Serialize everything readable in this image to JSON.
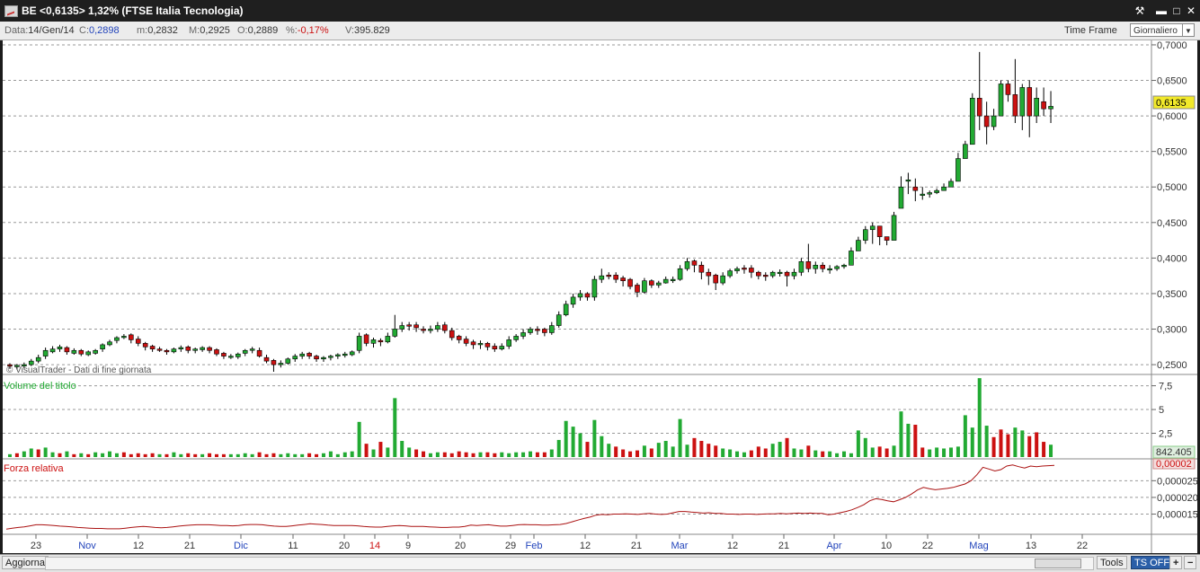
{
  "window": {
    "title": "BE <0,6135> 1,32%  (FTSE Italia Tecnologia)",
    "buttons": [
      "wrench-icon",
      "minimize-icon",
      "maximize-icon",
      "close-icon"
    ]
  },
  "info": {
    "date_label": "Data:",
    "date": "14/Gen/14",
    "close_label": "C:",
    "close": "0,2898",
    "min_label": "m:",
    "min": "0,2832",
    "max_label": "M:",
    "max": "0,2925",
    "open_label": "O:",
    "open": "0,2889",
    "pct_label": "%:",
    "pct": "-0,17%",
    "vol_label": "V:",
    "vol": "395.829",
    "time_frame_label": "Time Frame",
    "time_frame_value": "Giornaliero"
  },
  "price_panel": {
    "watermark": "© VisualTrader - Dati di fine giornata",
    "y_ticks": [
      "0,7000",
      "0,6500",
      "0,6000",
      "0,5500",
      "0,5000",
      "0,4500",
      "0,4000",
      "0,3500",
      "0,3000",
      "0,2500"
    ],
    "last_price_label": "0,6135"
  },
  "volume_panel": {
    "title": "Volume del titolo",
    "y_ticks": [
      "7,5",
      "5",
      "2,5"
    ],
    "last_label": "842.405"
  },
  "rs_panel": {
    "title": "Forza relativa",
    "y_ticks": [
      "0,000025",
      "0,000020",
      "0,000015"
    ],
    "last_label": "0,00002"
  },
  "x_axis": {
    "labels": [
      "23",
      "Nov",
      "12",
      "21",
      "Dic",
      "11",
      "20",
      "14",
      "9",
      "20",
      "29",
      "Feb",
      "12",
      "21",
      "Mar",
      "12",
      "21",
      "Apr",
      "10",
      "22",
      "Mag",
      "13",
      "22"
    ]
  },
  "bottom": {
    "refresh_label": "Aggiorna",
    "tools_label": "Tools",
    "ts_label": "TS OFF",
    "plus_label": "+",
    "minus_label": "−"
  },
  "colors": {
    "up": "#22aa33",
    "down": "#cc1111",
    "rs_line": "#aa1111",
    "grid": "#999999",
    "accent_label": "#f2e92a"
  },
  "chart_data": [
    {
      "type": "candlestick",
      "title": "BE <0,6135> 1,32%  (FTSE Italia Tecnologia)",
      "ylim": [
        0.24,
        0.705
      ],
      "x_labels": [
        "23",
        "Nov",
        "12",
        "21",
        "Dic",
        "11",
        "20",
        "14",
        "9",
        "20",
        "29",
        "Feb",
        "12",
        "21",
        "Mar",
        "12",
        "21",
        "Apr",
        "10",
        "22",
        "Mag",
        "13",
        "22"
      ],
      "close": [
        0.248,
        0.249,
        0.25,
        0.255,
        0.26,
        0.27,
        0.272,
        0.275,
        0.268,
        0.27,
        0.265,
        0.268,
        0.27,
        0.278,
        0.282,
        0.288,
        0.29,
        0.285,
        0.28,
        0.275,
        0.272,
        0.27,
        0.268,
        0.272,
        0.274,
        0.27,
        0.272,
        0.274,
        0.27,
        0.265,
        0.262,
        0.262,
        0.265,
        0.27,
        0.272,
        0.262,
        0.255,
        0.25,
        0.252,
        0.258,
        0.262,
        0.265,
        0.262,
        0.258,
        0.26,
        0.262,
        0.264,
        0.265,
        0.268,
        0.29,
        0.28,
        0.285,
        0.282,
        0.29,
        0.3,
        0.305,
        0.305,
        0.302,
        0.298,
        0.3,
        0.305,
        0.298,
        0.288,
        0.285,
        0.28,
        0.278,
        0.28,
        0.275,
        0.272,
        0.276,
        0.285,
        0.29,
        0.295,
        0.3,
        0.298,
        0.295,
        0.305,
        0.32,
        0.335,
        0.345,
        0.35,
        0.345,
        0.37,
        0.375,
        0.375,
        0.37,
        0.368,
        0.36,
        0.352,
        0.368,
        0.362,
        0.365,
        0.37,
        0.37,
        0.385,
        0.395,
        0.39,
        0.38,
        0.375,
        0.365,
        0.375,
        0.382,
        0.385,
        0.385,
        0.38,
        0.375,
        0.375,
        0.38,
        0.38,
        0.375,
        0.38,
        0.395,
        0.385,
        0.39,
        0.385,
        0.385,
        0.388,
        0.39,
        0.41,
        0.425,
        0.44,
        0.445,
        0.43,
        0.425,
        0.46,
        0.5,
        0.51,
        0.495,
        0.49,
        0.492,
        0.495,
        0.5,
        0.508,
        0.54,
        0.56,
        0.625,
        0.6,
        0.585,
        0.6,
        0.645,
        0.63,
        0.6,
        0.64,
        0.6,
        0.625,
        0.61,
        0.6135
      ],
      "open": [
        0.25,
        0.247,
        0.248,
        0.25,
        0.255,
        0.262,
        0.268,
        0.272,
        0.274,
        0.266,
        0.27,
        0.264,
        0.266,
        0.272,
        0.278,
        0.284,
        0.29,
        0.292,
        0.286,
        0.28,
        0.276,
        0.272,
        0.27,
        0.268,
        0.272,
        0.275,
        0.27,
        0.271,
        0.274,
        0.271,
        0.266,
        0.262,
        0.261,
        0.266,
        0.272,
        0.27,
        0.26,
        0.256,
        0.25,
        0.252,
        0.258,
        0.262,
        0.266,
        0.262,
        0.258,
        0.26,
        0.262,
        0.263,
        0.264,
        0.27,
        0.292,
        0.28,
        0.284,
        0.282,
        0.29,
        0.3,
        0.306,
        0.306,
        0.3,
        0.298,
        0.3,
        0.306,
        0.298,
        0.29,
        0.286,
        0.282,
        0.278,
        0.28,
        0.276,
        0.272,
        0.276,
        0.285,
        0.29,
        0.295,
        0.3,
        0.3,
        0.295,
        0.305,
        0.32,
        0.335,
        0.345,
        0.35,
        0.345,
        0.37,
        0.376,
        0.376,
        0.372,
        0.37,
        0.362,
        0.352,
        0.368,
        0.362,
        0.365,
        0.37,
        0.37,
        0.385,
        0.396,
        0.39,
        0.38,
        0.376,
        0.365,
        0.375,
        0.382,
        0.386,
        0.386,
        0.38,
        0.376,
        0.375,
        0.38,
        0.38,
        0.375,
        0.38,
        0.395,
        0.385,
        0.39,
        0.385,
        0.385,
        0.388,
        0.39,
        0.41,
        0.425,
        0.44,
        0.445,
        0.43,
        0.425,
        0.47,
        0.51,
        0.5,
        0.49,
        0.49,
        0.492,
        0.495,
        0.5,
        0.508,
        0.54,
        0.56,
        0.625,
        0.6,
        0.585,
        0.6,
        0.645,
        0.63,
        0.6,
        0.64,
        0.6,
        0.62,
        0.61
      ],
      "high": [
        0.252,
        0.251,
        0.253,
        0.258,
        0.264,
        0.274,
        0.276,
        0.278,
        0.276,
        0.273,
        0.272,
        0.27,
        0.272,
        0.28,
        0.285,
        0.29,
        0.293,
        0.294,
        0.29,
        0.282,
        0.278,
        0.275,
        0.272,
        0.274,
        0.277,
        0.277,
        0.274,
        0.276,
        0.276,
        0.273,
        0.268,
        0.265,
        0.267,
        0.272,
        0.275,
        0.274,
        0.264,
        0.258,
        0.256,
        0.26,
        0.265,
        0.268,
        0.268,
        0.264,
        0.262,
        0.264,
        0.266,
        0.268,
        0.27,
        0.295,
        0.294,
        0.288,
        0.287,
        0.295,
        0.32,
        0.31,
        0.31,
        0.31,
        0.304,
        0.305,
        0.31,
        0.31,
        0.302,
        0.292,
        0.29,
        0.285,
        0.284,
        0.282,
        0.28,
        0.28,
        0.29,
        0.293,
        0.3,
        0.303,
        0.304,
        0.302,
        0.31,
        0.325,
        0.34,
        0.35,
        0.355,
        0.352,
        0.375,
        0.385,
        0.38,
        0.38,
        0.375,
        0.372,
        0.365,
        0.372,
        0.37,
        0.368,
        0.374,
        0.374,
        0.39,
        0.4,
        0.398,
        0.395,
        0.385,
        0.378,
        0.38,
        0.385,
        0.388,
        0.39,
        0.39,
        0.382,
        0.38,
        0.382,
        0.384,
        0.382,
        0.385,
        0.4,
        0.42,
        0.395,
        0.394,
        0.39,
        0.39,
        0.392,
        0.415,
        0.43,
        0.445,
        0.45,
        0.445,
        0.43,
        0.465,
        0.515,
        0.52,
        0.512,
        0.5,
        0.495,
        0.498,
        0.505,
        0.512,
        0.548,
        0.565,
        0.632,
        0.69,
        0.62,
        0.61,
        0.65,
        0.65,
        0.68,
        0.645,
        0.65,
        0.64,
        0.64,
        0.635
      ],
      "low": [
        0.244,
        0.243,
        0.245,
        0.248,
        0.252,
        0.258,
        0.266,
        0.268,
        0.264,
        0.264,
        0.262,
        0.262,
        0.264,
        0.268,
        0.276,
        0.28,
        0.286,
        0.28,
        0.276,
        0.27,
        0.268,
        0.268,
        0.264,
        0.266,
        0.268,
        0.266,
        0.266,
        0.268,
        0.266,
        0.262,
        0.258,
        0.258,
        0.258,
        0.262,
        0.266,
        0.26,
        0.252,
        0.24,
        0.246,
        0.25,
        0.254,
        0.258,
        0.258,
        0.254,
        0.254,
        0.256,
        0.258,
        0.26,
        0.262,
        0.266,
        0.276,
        0.274,
        0.276,
        0.28,
        0.288,
        0.296,
        0.298,
        0.296,
        0.294,
        0.294,
        0.296,
        0.294,
        0.284,
        0.28,
        0.276,
        0.272,
        0.272,
        0.27,
        0.268,
        0.27,
        0.272,
        0.282,
        0.286,
        0.292,
        0.292,
        0.29,
        0.292,
        0.302,
        0.318,
        0.33,
        0.34,
        0.34,
        0.34,
        0.365,
        0.37,
        0.365,
        0.36,
        0.356,
        0.345,
        0.35,
        0.358,
        0.358,
        0.364,
        0.365,
        0.368,
        0.382,
        0.38,
        0.37,
        0.362,
        0.355,
        0.362,
        0.372,
        0.378,
        0.378,
        0.372,
        0.37,
        0.368,
        0.372,
        0.374,
        0.36,
        0.37,
        0.375,
        0.38,
        0.378,
        0.38,
        0.378,
        0.382,
        0.385,
        0.405,
        0.418,
        0.42,
        0.42,
        0.418,
        0.418,
        0.455,
        0.48,
        0.49,
        0.48,
        0.482,
        0.485,
        0.49,
        0.495,
        0.505,
        0.53,
        0.55,
        0.6,
        0.58,
        0.56,
        0.58,
        0.6,
        0.62,
        0.59,
        0.58,
        0.57,
        0.59,
        0.6,
        0.59
      ]
    },
    {
      "type": "bar",
      "title": "Volume del titolo",
      "ylim": [
        0,
        8.5
      ],
      "values": [
        0.3,
        0.4,
        0.6,
        0.9,
        0.8,
        1.0,
        0.5,
        0.4,
        0.6,
        0.3,
        0.4,
        0.3,
        0.5,
        0.4,
        0.6,
        0.4,
        0.5,
        0.3,
        0.4,
        0.3,
        0.4,
        0.3,
        0.3,
        0.5,
        0.3,
        0.4,
        0.3,
        0.3,
        0.4,
        0.3,
        0.3,
        0.3,
        0.3,
        0.4,
        0.3,
        0.5,
        0.3,
        0.4,
        0.3,
        0.4,
        0.3,
        0.3,
        0.4,
        0.3,
        0.4,
        0.6,
        0.3,
        0.5,
        0.6,
        3.7,
        1.4,
        0.8,
        1.6,
        1.0,
        6.2,
        1.7,
        1.0,
        0.8,
        0.6,
        0.4,
        0.5,
        0.5,
        0.4,
        0.6,
        0.5,
        0.4,
        0.5,
        0.5,
        0.4,
        0.5,
        0.4,
        0.5,
        0.5,
        0.6,
        0.5,
        0.5,
        0.8,
        1.8,
        3.8,
        3.2,
        2.5,
        1.6,
        3.9,
        2.2,
        1.4,
        1.1,
        0.8,
        0.6,
        0.7,
        1.2,
        0.9,
        1.5,
        1.7,
        1.1,
        4.0,
        1.3,
        2.0,
        1.7,
        1.4,
        1.2,
        0.9,
        0.8,
        0.6,
        0.5,
        0.7,
        1.1,
        0.9,
        1.4,
        1.6,
        2.0,
        0.9,
        0.8,
        1.2,
        0.7,
        0.6,
        0.6,
        0.4,
        0.6,
        0.4,
        2.8,
        2.0,
        1.0,
        1.1,
        0.9,
        1.2,
        4.8,
        3.5,
        3.4,
        1.0,
        0.8,
        1.0,
        0.9,
        1.0,
        1.1,
        4.4,
        3.1,
        8.3,
        3.3,
        2.1,
        2.9,
        2.4,
        3.1,
        2.8,
        2.2,
        2.6,
        1.6,
        1.3,
        0.8
      ],
      "colors": [
        "up",
        "down",
        "up",
        "up",
        "down",
        "up",
        "up",
        "down",
        "up",
        "down",
        "up",
        "down",
        "up",
        "up",
        "up",
        "up",
        "down",
        "down",
        "down",
        "down",
        "down",
        "up",
        "down",
        "up",
        "up",
        "down",
        "down",
        "up",
        "down",
        "down",
        "down",
        "up",
        "up",
        "up",
        "up",
        "down",
        "down",
        "down",
        "up",
        "up",
        "up",
        "up",
        "down",
        "down",
        "up",
        "up",
        "up",
        "up",
        "up",
        "up",
        "down",
        "up",
        "down",
        "up",
        "up",
        "up",
        "up",
        "down",
        "down",
        "up",
        "up",
        "down",
        "down",
        "down",
        "down",
        "down",
        "up",
        "down",
        "down",
        "up",
        "up",
        "up",
        "up",
        "up",
        "down",
        "down",
        "up",
        "up",
        "up",
        "up",
        "up",
        "down",
        "up",
        "up",
        "up",
        "down",
        "down",
        "down",
        "down",
        "up",
        "down",
        "up",
        "up",
        "up",
        "up",
        "up",
        "down",
        "down",
        "down",
        "down",
        "up",
        "up",
        "up",
        "up",
        "down",
        "down",
        "down",
        "up",
        "up",
        "down",
        "up",
        "up",
        "down",
        "up",
        "down",
        "up",
        "up",
        "up",
        "up",
        "up",
        "up",
        "up",
        "down",
        "down",
        "up",
        "up",
        "up",
        "down",
        "down",
        "up",
        "up",
        "up",
        "up",
        "up",
        "up",
        "up",
        "up",
        "up",
        "down",
        "down",
        "down",
        "up",
        "up",
        "down",
        "down",
        "down",
        "up",
        "down",
        "up"
      ]
    },
    {
      "type": "line",
      "title": "Forza relativa",
      "ylim": [
        9.5e-06,
        3.1e-05
      ],
      "values": [
        1.05e-05,
        1.08e-05,
        1.1e-05,
        1.12e-05,
        1.15e-05,
        1.18e-05,
        1.18e-05,
        1.17e-05,
        1.16e-05,
        1.14e-05,
        1.13e-05,
        1.12e-05,
        1.1e-05,
        1.09e-05,
        1.08e-05,
        1.07e-05,
        1.07e-05,
        1.06e-05,
        1.06e-05,
        1.06e-05,
        1.08e-05,
        1.1e-05,
        1.12e-05,
        1.13e-05,
        1.12e-05,
        1.1e-05,
        1.09e-05,
        1.1e-05,
        1.12e-05,
        1.14e-05,
        1.16e-05,
        1.17e-05,
        1.18e-05,
        1.18e-05,
        1.18e-05,
        1.17e-05,
        1.16e-05,
        1.16e-05,
        1.15e-05,
        1.16e-05,
        1.18e-05,
        1.19e-05,
        1.19e-05,
        1.18e-05,
        1.16e-05,
        1.14e-05,
        1.13e-05,
        1.13e-05,
        1.15e-05,
        1.17e-05,
        1.19e-05,
        1.21e-05,
        1.2e-05,
        1.19e-05,
        1.17e-05,
        1.16e-05,
        1.16e-05,
        1.16e-05,
        1.16e-05,
        1.15e-05,
        1.13e-05,
        1.12e-05,
        1.11e-05,
        1.11e-05,
        1.13e-05,
        1.15e-05,
        1.16e-05,
        1.15e-05,
        1.13e-05,
        1.13e-05,
        1.13e-05,
        1.12e-05,
        1.11e-05,
        1.1e-05,
        1.1e-05,
        1.11e-05,
        1.11e-05,
        1.13e-05,
        1.17e-05,
        1.16e-05,
        1.17e-05,
        1.18e-05,
        1.16e-05,
        1.14e-05,
        1.14e-05,
        1.16e-05,
        1.18e-05,
        1.19e-05,
        1.18e-05,
        1.18e-05,
        1.17e-05,
        1.17e-05,
        1.18e-05,
        1.19e-05,
        1.22e-05,
        1.27e-05,
        1.32e-05,
        1.37e-05,
        1.41e-05,
        1.47e-05,
        1.49e-05,
        1.48e-05,
        1.5e-05,
        1.5e-05,
        1.51e-05,
        1.5e-05,
        1.49e-05,
        1.51e-05,
        1.52e-05,
        1.5e-05,
        1.49e-05,
        1.5e-05,
        1.54e-05,
        1.58e-05,
        1.58e-05,
        1.56e-05,
        1.55e-05,
        1.53e-05,
        1.54e-05,
        1.52e-05,
        1.52e-05,
        1.5e-05,
        1.5e-05,
        1.49e-05,
        1.5e-05,
        1.5e-05,
        1.49e-05,
        1.5e-05,
        1.51e-05,
        1.51e-05,
        1.52e-05,
        1.51e-05,
        1.52e-05,
        1.53e-05,
        1.52e-05,
        1.53e-05,
        1.52e-05,
        1.52e-05,
        1.48e-05,
        1.5e-05,
        1.54e-05,
        1.58e-05,
        1.63e-05,
        1.7e-05,
        1.78e-05,
        1.9e-05,
        1.96e-05,
        1.94e-05,
        1.9e-05,
        1.87e-05,
        1.93e-05,
        2e-05,
        2.1e-05,
        2.22e-05,
        2.3e-05,
        2.26e-05,
        2.23e-05,
        2.25e-05,
        2.27e-05,
        2.3e-05,
        2.35e-05,
        2.4e-05,
        2.5e-05,
        2.68e-05,
        2.9e-05,
        2.85e-05,
        2.79e-05,
        2.83e-05,
        2.94e-05,
        2.97e-05,
        2.92e-05,
        2.88e-05,
        2.94e-05,
        2.92e-05,
        2.94e-05,
        2.95e-05,
        2.96e-05
      ]
    }
  ]
}
